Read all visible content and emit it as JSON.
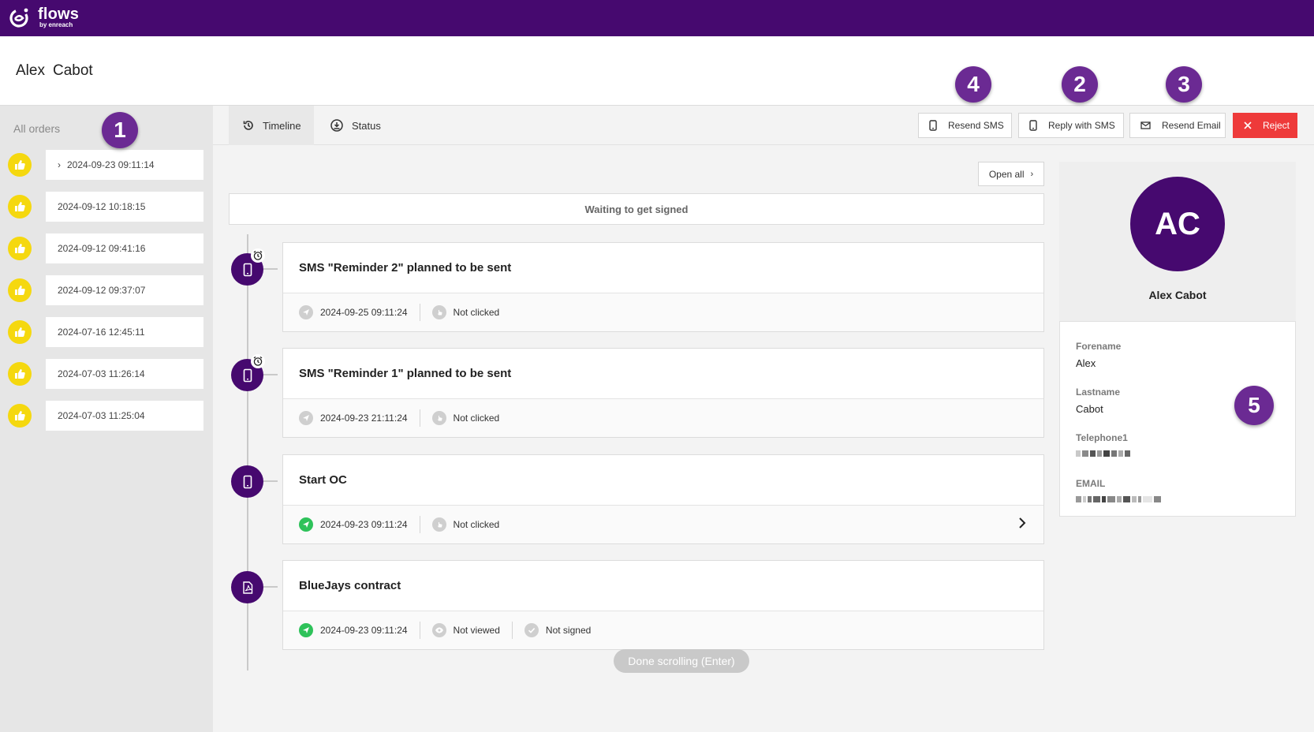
{
  "app": {
    "logo_title": "flows",
    "logo_subtitle": "by enreach",
    "brand_color": "#46096f",
    "accent_yellow": "#f5d80f",
    "reject_color": "#ee3a3a"
  },
  "customer": {
    "forename": "Alex",
    "lastname": "Cabot"
  },
  "sidebar": {
    "title": "All orders",
    "orders": [
      {
        "date": "2024-09-23 09:11:14",
        "expanded": true
      },
      {
        "date": "2024-09-12 10:18:15"
      },
      {
        "date": "2024-09-12 09:41:16"
      },
      {
        "date": "2024-09-12 09:37:07"
      },
      {
        "date": "2024-07-16 12:45:11"
      },
      {
        "date": "2024-07-03 11:26:14"
      },
      {
        "date": "2024-07-03 11:25:04"
      }
    ]
  },
  "tabs": [
    {
      "label": "Timeline",
      "icon": "history-icon",
      "active": true
    },
    {
      "label": "Status",
      "icon": "status-icon",
      "active": false
    }
  ],
  "actions": {
    "resend_sms": "Resend SMS",
    "reply_sms": "Reply with SMS",
    "resend_email": "Resend Email",
    "reject": "Reject"
  },
  "callouts": [
    "1",
    "2",
    "3",
    "4",
    "5"
  ],
  "timeline": {
    "open_all": "Open all",
    "status_banner": "Waiting to get signed",
    "events": [
      {
        "title": "SMS \"Reminder 2\" planned to be sent",
        "icon": "phone-icon",
        "scheduled": true,
        "meta": [
          {
            "icon": "send-icon",
            "status": "grey",
            "text": "2024-09-25 09:11:24"
          },
          {
            "icon": "click-icon",
            "status": "grey",
            "text": "Not clicked"
          }
        ]
      },
      {
        "title": "SMS \"Reminder 1\" planned to be sent",
        "icon": "phone-icon",
        "scheduled": true,
        "meta": [
          {
            "icon": "send-icon",
            "status": "grey",
            "text": "2024-09-23 21:11:24"
          },
          {
            "icon": "click-icon",
            "status": "grey",
            "text": "Not clicked"
          }
        ]
      },
      {
        "title": "Start OC",
        "icon": "phone-icon",
        "scheduled": false,
        "meta": [
          {
            "icon": "send-icon",
            "status": "green",
            "text": "2024-09-23 09:11:24"
          },
          {
            "icon": "click-icon",
            "status": "grey",
            "text": "Not clicked"
          }
        ],
        "expandable": true
      },
      {
        "title": "BlueJays contract",
        "icon": "pdf-icon",
        "scheduled": false,
        "meta": [
          {
            "icon": "send-icon",
            "status": "green",
            "text": "2024-09-23 09:11:24"
          },
          {
            "icon": "eye-icon",
            "status": "grey",
            "text": "Not viewed"
          },
          {
            "icon": "check-icon",
            "status": "grey",
            "text": "Not signed"
          }
        ]
      }
    ]
  },
  "toast": "Done scrolling (Enter)",
  "profile": {
    "initials": "AC",
    "full_name": "Alex Cabot",
    "fields": [
      {
        "label": "Forename",
        "value": "Alex"
      },
      {
        "label": "Lastname",
        "value": "Cabot"
      },
      {
        "label": "Telephone1",
        "value": null,
        "redacted": true
      },
      {
        "label": "EMAIL",
        "value": null,
        "redacted": true
      }
    ]
  }
}
